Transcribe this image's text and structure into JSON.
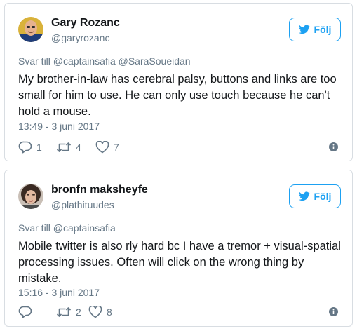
{
  "colors": {
    "accent": "#1da1f2",
    "text_primary": "#14171a",
    "text_secondary": "#657786",
    "border": "#d8dde2"
  },
  "tweets": [
    {
      "name": "Gary Rozanc",
      "handle": "@garyrozanc",
      "follow_label": "Följ",
      "reply_prefix": "Svar till",
      "reply_mentions": [
        "@captainsafia",
        "@SaraSoueidan"
      ],
      "text": "My brother-in-law has cerebral palsy, buttons and links are too small for him to use. He can only use touch because he can't hold a mouse.",
      "timestamp": "13:49 - 3 juni 2017",
      "actions": {
        "reply_count": "1",
        "retweet_count": "4",
        "like_count": "7"
      },
      "icons": [
        "twitter-bird-icon",
        "reply-icon",
        "retweet-icon",
        "heart-icon",
        "info-icon"
      ]
    },
    {
      "name": "bronfn maksheyfe",
      "handle": "@plathituudes",
      "follow_label": "Följ",
      "reply_prefix": "Svar till",
      "reply_mentions": [
        "@captainsafia"
      ],
      "text": "Mobile twitter is also rly hard bc I have a tremor + visual-spatial processing issues. Often will click on the wrong thing by mistake.",
      "timestamp": "15:16 - 3 juni 2017",
      "actions": {
        "reply_count": "",
        "retweet_count": "2",
        "like_count": "8"
      },
      "icons": [
        "twitter-bird-icon",
        "reply-icon",
        "retweet-icon",
        "heart-icon",
        "info-icon"
      ]
    }
  ]
}
